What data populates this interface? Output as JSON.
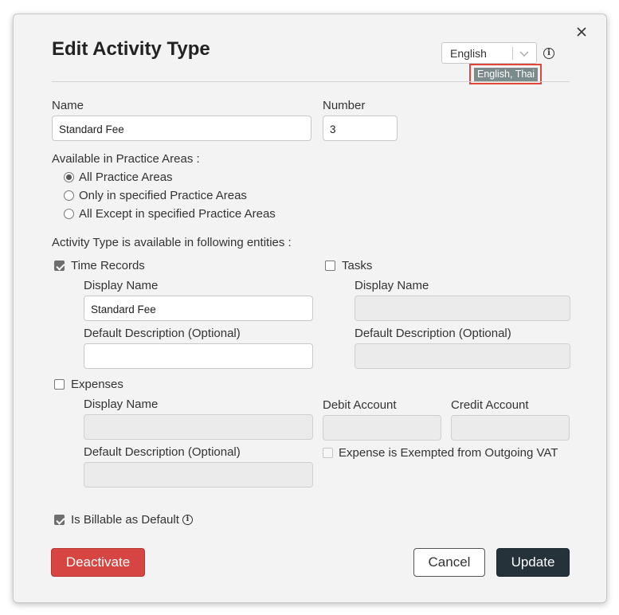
{
  "dialog": {
    "title": "Edit Activity Type",
    "language": {
      "selected": "English",
      "tooltip": "English, Thai"
    },
    "name": {
      "label": "Name",
      "value": "Standard Fee"
    },
    "number": {
      "label": "Number",
      "value": "3"
    },
    "practice_areas": {
      "label": "Available in Practice Areas :",
      "options": [
        "All Practice Areas",
        "Only in specified Practice Areas",
        "All Except in specified Practice Areas"
      ],
      "selected_index": 0
    },
    "entities_label": "Activity Type is available in following entities :",
    "time_records": {
      "label": "Time Records",
      "checked": true,
      "display_name_label": "Display Name",
      "display_name_value": "Standard Fee",
      "default_description_label": "Default Description (Optional)",
      "default_description_value": ""
    },
    "tasks": {
      "label": "Tasks",
      "checked": false,
      "display_name_label": "Display Name",
      "display_name_value": "",
      "default_description_label": "Default Description (Optional)",
      "default_description_value": ""
    },
    "expenses": {
      "label": "Expenses",
      "checked": false,
      "display_name_label": "Display Name",
      "default_description_label": "Default Description (Optional)",
      "debit_account_label": "Debit Account",
      "credit_account_label": "Credit Account",
      "vat_exempt_label": "Expense is Exempted from Outgoing VAT",
      "vat_exempt_checked": false
    },
    "billable": {
      "label": "Is Billable as Default",
      "checked": true
    },
    "buttons": {
      "deactivate": "Deactivate",
      "cancel": "Cancel",
      "update": "Update"
    },
    "colors": {
      "deactivate": "#d64541",
      "update": "#26323a",
      "highlight_border": "#e0463c",
      "tooltip_bg": "#7b8a8b"
    }
  }
}
